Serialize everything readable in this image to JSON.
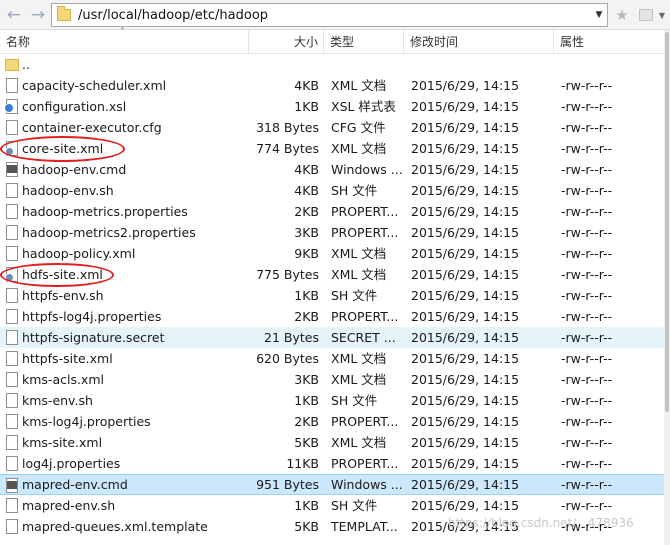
{
  "address_bar": {
    "path": "/usr/local/hadoop/etc/hadoop"
  },
  "columns": {
    "name": "名称",
    "size": "大小",
    "type": "类型",
    "modified": "修改时间",
    "attributes": "属性"
  },
  "files": [
    {
      "name": "..",
      "size": "",
      "type": "",
      "modified": "",
      "attr": "",
      "icon": "parent-folder-icon"
    },
    {
      "name": "capacity-scheduler.xml",
      "size": "4KB",
      "type": "XML 文档",
      "modified": "2015/6/29, 14:15",
      "attr": "-rw-r--r--",
      "icon": "file-icon"
    },
    {
      "name": "configuration.xsl",
      "size": "1KB",
      "type": "XSL 样式表",
      "modified": "2015/6/29, 14:15",
      "attr": "-rw-r--r--",
      "icon": "xsl-file-icon"
    },
    {
      "name": "container-executor.cfg",
      "size": "318 Bytes",
      "type": "CFG 文件",
      "modified": "2015/6/29, 14:15",
      "attr": "-rw-r--r--",
      "icon": "file-icon"
    },
    {
      "name": "core-site.xml",
      "size": "774 Bytes",
      "type": "XML 文档",
      "modified": "2015/6/29, 14:15",
      "attr": "-rw-r--r--",
      "icon": "xml-gear-file-icon"
    },
    {
      "name": "hadoop-env.cmd",
      "size": "4KB",
      "type": "Windows ...",
      "modified": "2015/6/29, 14:15",
      "attr": "-rw-r--r--",
      "icon": "cmd-file-icon"
    },
    {
      "name": "hadoop-env.sh",
      "size": "4KB",
      "type": "SH 文件",
      "modified": "2015/6/29, 14:15",
      "attr": "-rw-r--r--",
      "icon": "file-icon"
    },
    {
      "name": "hadoop-metrics.properties",
      "size": "2KB",
      "type": "PROPERT...",
      "modified": "2015/6/29, 14:15",
      "attr": "-rw-r--r--",
      "icon": "file-icon"
    },
    {
      "name": "hadoop-metrics2.properties",
      "size": "3KB",
      "type": "PROPERT...",
      "modified": "2015/6/29, 14:15",
      "attr": "-rw-r--r--",
      "icon": "file-icon"
    },
    {
      "name": "hadoop-policy.xml",
      "size": "9KB",
      "type": "XML 文档",
      "modified": "2015/6/29, 14:15",
      "attr": "-rw-r--r--",
      "icon": "file-icon"
    },
    {
      "name": "hdfs-site.xml",
      "size": "775 Bytes",
      "type": "XML 文档",
      "modified": "2015/6/29, 14:15",
      "attr": "-rw-r--r--",
      "icon": "xml-gear-file-icon"
    },
    {
      "name": "httpfs-env.sh",
      "size": "1KB",
      "type": "SH 文件",
      "modified": "2015/6/29, 14:15",
      "attr": "-rw-r--r--",
      "icon": "file-icon"
    },
    {
      "name": "httpfs-log4j.properties",
      "size": "2KB",
      "type": "PROPERT...",
      "modified": "2015/6/29, 14:15",
      "attr": "-rw-r--r--",
      "icon": "file-icon"
    },
    {
      "name": "httpfs-signature.secret",
      "size": "21 Bytes",
      "type": "SECRET ...",
      "modified": "2015/6/29, 14:15",
      "attr": "-rw-r--r--",
      "icon": "file-icon",
      "state": "hover"
    },
    {
      "name": "httpfs-site.xml",
      "size": "620 Bytes",
      "type": "XML 文档",
      "modified": "2015/6/29, 14:15",
      "attr": "-rw-r--r--",
      "icon": "file-icon"
    },
    {
      "name": "kms-acls.xml",
      "size": "3KB",
      "type": "XML 文档",
      "modified": "2015/6/29, 14:15",
      "attr": "-rw-r--r--",
      "icon": "file-icon"
    },
    {
      "name": "kms-env.sh",
      "size": "1KB",
      "type": "SH 文件",
      "modified": "2015/6/29, 14:15",
      "attr": "-rw-r--r--",
      "icon": "file-icon"
    },
    {
      "name": "kms-log4j.properties",
      "size": "2KB",
      "type": "PROPERT...",
      "modified": "2015/6/29, 14:15",
      "attr": "-rw-r--r--",
      "icon": "file-icon"
    },
    {
      "name": "kms-site.xml",
      "size": "5KB",
      "type": "XML 文档",
      "modified": "2015/6/29, 14:15",
      "attr": "-rw-r--r--",
      "icon": "file-icon"
    },
    {
      "name": "log4j.properties",
      "size": "11KB",
      "type": "PROPERT...",
      "modified": "2015/6/29, 14:15",
      "attr": "-rw-r--r--",
      "icon": "file-icon"
    },
    {
      "name": "mapred-env.cmd",
      "size": "951 Bytes",
      "type": "Windows ...",
      "modified": "2015/6/29, 14:15",
      "attr": "-rw-r--r--",
      "icon": "cmd-file-icon",
      "state": "selected"
    },
    {
      "name": "mapred-env.sh",
      "size": "1KB",
      "type": "SH 文件",
      "modified": "2015/6/29, 14:15",
      "attr": "-rw-r--r--",
      "icon": "file-icon"
    },
    {
      "name": "mapred-queues.xml.template",
      "size": "5KB",
      "type": "TEMPLAT...",
      "modified": "2015/6/29, 14:15",
      "attr": "-rw-r--r--",
      "icon": "file-icon"
    }
  ],
  "watermark": "https://blog.csdn.net/...478936",
  "colors": {
    "hover_row": "#e5f3fb",
    "selected_row": "#cce8ff",
    "annotation_ring": "#e0201f"
  }
}
